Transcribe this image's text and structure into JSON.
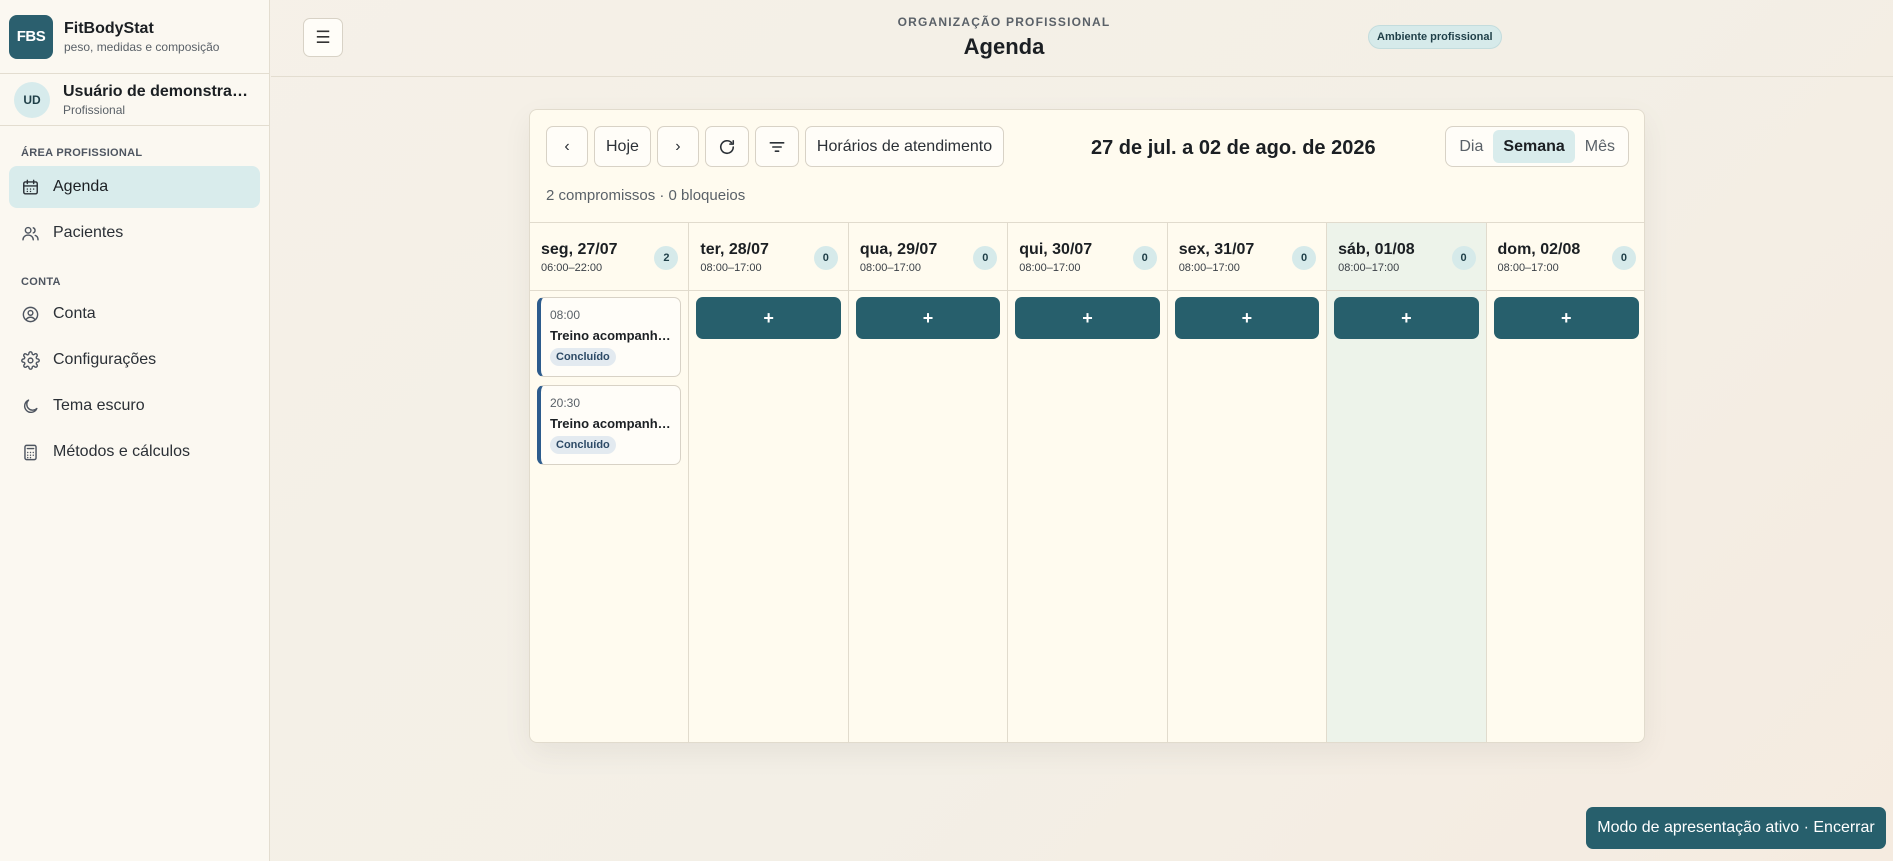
{
  "brand": {
    "logo": "FBS",
    "title": "FitBodyStat",
    "subtitle": "peso, medidas e composição"
  },
  "user": {
    "initials": "UD",
    "name": "Usuário de demonstração",
    "role": "Profissional"
  },
  "sidebar": {
    "sections": [
      {
        "label": "ÁREA PROFISSIONAL",
        "items": [
          {
            "label": "Agenda",
            "icon": "calendar-icon",
            "active": true
          },
          {
            "label": "Pacientes",
            "icon": "users-icon",
            "active": false
          }
        ]
      },
      {
        "label": "CONTA",
        "items": [
          {
            "label": "Conta",
            "icon": "user-circle-icon",
            "active": false
          },
          {
            "label": "Configurações",
            "icon": "gear-icon",
            "active": false
          },
          {
            "label": "Tema escuro",
            "icon": "moon-icon",
            "active": false
          },
          {
            "label": "Métodos e cálculos",
            "icon": "calculator-icon",
            "active": false
          }
        ]
      }
    ]
  },
  "header": {
    "menu_icon": "☰",
    "kicker": "ORGANIZAÇÃO PROFISSIONAL",
    "title": "Agenda",
    "badge": "Ambiente profissional"
  },
  "toolbar": {
    "prev": "‹",
    "today": "Hoje",
    "next": "›",
    "refresh_icon": "refresh-icon",
    "filter_icon": "filter-icon",
    "hours": "Horários de atendimento",
    "range": "27 de jul. a 02 de ago. de 2026",
    "views": [
      {
        "label": "Dia",
        "active": false
      },
      {
        "label": "Semana",
        "active": true
      },
      {
        "label": "Mês",
        "active": false
      }
    ],
    "summary": "2 compromissos · 0 bloqueios"
  },
  "days": [
    {
      "label": "seg, 27/07",
      "hours": "06:00–22:00",
      "count": "2",
      "has_add": false,
      "events": [
        {
          "time": "08:00",
          "title": "Treino acompanhado",
          "status": "Concluído"
        },
        {
          "time": "20:30",
          "title": "Treino acompanhado",
          "status": "Concluído"
        }
      ]
    },
    {
      "label": "ter, 28/07",
      "hours": "08:00–17:00",
      "count": "0",
      "has_add": true,
      "events": []
    },
    {
      "label": "qua, 29/07",
      "hours": "08:00–17:00",
      "count": "0",
      "has_add": true,
      "events": []
    },
    {
      "label": "qui, 30/07",
      "hours": "08:00–17:00",
      "count": "0",
      "has_add": true,
      "events": []
    },
    {
      "label": "sex, 31/07",
      "hours": "08:00–17:00",
      "count": "0",
      "has_add": true,
      "events": []
    },
    {
      "label": "sáb, 01/08",
      "hours": "08:00–17:00",
      "count": "0",
      "has_add": true,
      "events": []
    },
    {
      "label": "dom, 02/08",
      "hours": "08:00–17:00",
      "count": "0",
      "has_add": true,
      "events": []
    }
  ],
  "add_label": "+",
  "toast": "Modo de apresentação ativo · Encerrar"
}
